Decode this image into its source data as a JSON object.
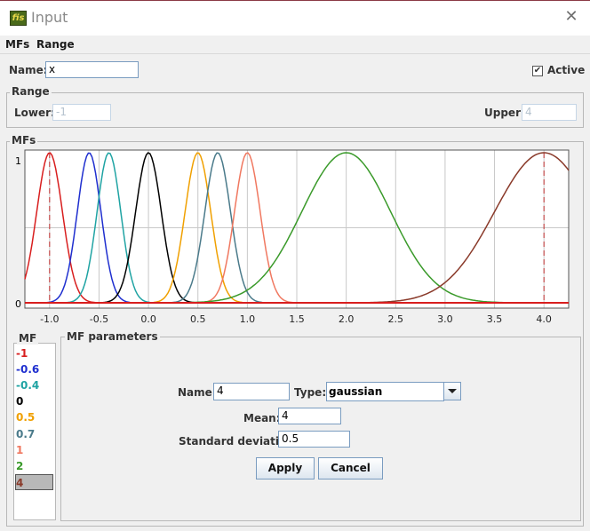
{
  "window": {
    "title": "Input",
    "icon_text": "fis",
    "close_glyph": "✕"
  },
  "menu": {
    "items": [
      "MFs",
      "Range"
    ]
  },
  "name_row": {
    "label": "Name:",
    "value": "x",
    "active_label": "Active",
    "active_checked": true,
    "check_glyph": "✔"
  },
  "range": {
    "title": "Range",
    "lower_label": "Lower:",
    "lower_value": "-1",
    "upper_label": "Upper:",
    "upper_value": "4"
  },
  "mfs_group": {
    "title": "MFs"
  },
  "chart_data": {
    "type": "line",
    "xlim": [
      -1.25,
      4.25
    ],
    "ylim": [
      0,
      1
    ],
    "x_ticks": [
      "-1.0",
      "-0.5",
      "0.0",
      "0.5",
      "1.0",
      "1.5",
      "2.0",
      "2.5",
      "3.0",
      "3.5",
      "4.0"
    ],
    "x_tick_values": [
      -1.0,
      -0.5,
      0.0,
      0.5,
      1.0,
      1.5,
      2.0,
      2.5,
      3.0,
      3.5,
      4.0
    ],
    "y_ticks": [
      "0",
      "1"
    ],
    "range_markers": [
      -1,
      4
    ],
    "series": [
      {
        "name": "-1",
        "type": "gaussian",
        "mean": -1.0,
        "sigma": 0.13,
        "color": "#d81e1e"
      },
      {
        "name": "-0.6",
        "type": "gaussian",
        "mean": -0.6,
        "sigma": 0.12,
        "color": "#1f2fcf"
      },
      {
        "name": "-0.4",
        "type": "gaussian",
        "mean": -0.4,
        "sigma": 0.12,
        "color": "#1fa3a3"
      },
      {
        "name": "0",
        "type": "gaussian",
        "mean": 0.0,
        "sigma": 0.13,
        "color": "#000000"
      },
      {
        "name": "0.5",
        "type": "gaussian",
        "mean": 0.5,
        "sigma": 0.13,
        "color": "#f0a000"
      },
      {
        "name": "0.7",
        "type": "gaussian",
        "mean": 0.7,
        "sigma": 0.13,
        "color": "#4a7a8a"
      },
      {
        "name": "1",
        "type": "gaussian",
        "mean": 1.0,
        "sigma": 0.13,
        "color": "#f07860"
      },
      {
        "name": "2",
        "type": "gaussian",
        "mean": 2.0,
        "sigma": 0.45,
        "color": "#3a9a2a"
      },
      {
        "name": "4",
        "type": "gaussian",
        "mean": 4.0,
        "sigma": 0.5,
        "color": "#8a3a2a"
      }
    ],
    "baseline_color": "#d81e1e"
  },
  "mf_list": {
    "title": "MF",
    "items": [
      {
        "label": "-1",
        "color": "#d81e1e"
      },
      {
        "label": "-0.6",
        "color": "#1f2fcf"
      },
      {
        "label": "-0.4",
        "color": "#1fa3a3"
      },
      {
        "label": "0",
        "color": "#000000"
      },
      {
        "label": "0.5",
        "color": "#f0a000"
      },
      {
        "label": "0.7",
        "color": "#4a7a8a"
      },
      {
        "label": "1",
        "color": "#f07860"
      },
      {
        "label": "2",
        "color": "#3a9a2a"
      },
      {
        "label": "4",
        "color": "#8a3a2a"
      }
    ],
    "selected_index": 8
  },
  "mf_params": {
    "title": "MF parameters",
    "name_label": "Name:",
    "name_value": "4",
    "type_label": "Type:",
    "type_value": "gaussian",
    "mean_label": "Mean:",
    "mean_value": "4",
    "sd_label": "Standard deviation:",
    "sd_value": "0.5",
    "apply_label": "Apply",
    "cancel_label": "Cancel"
  }
}
